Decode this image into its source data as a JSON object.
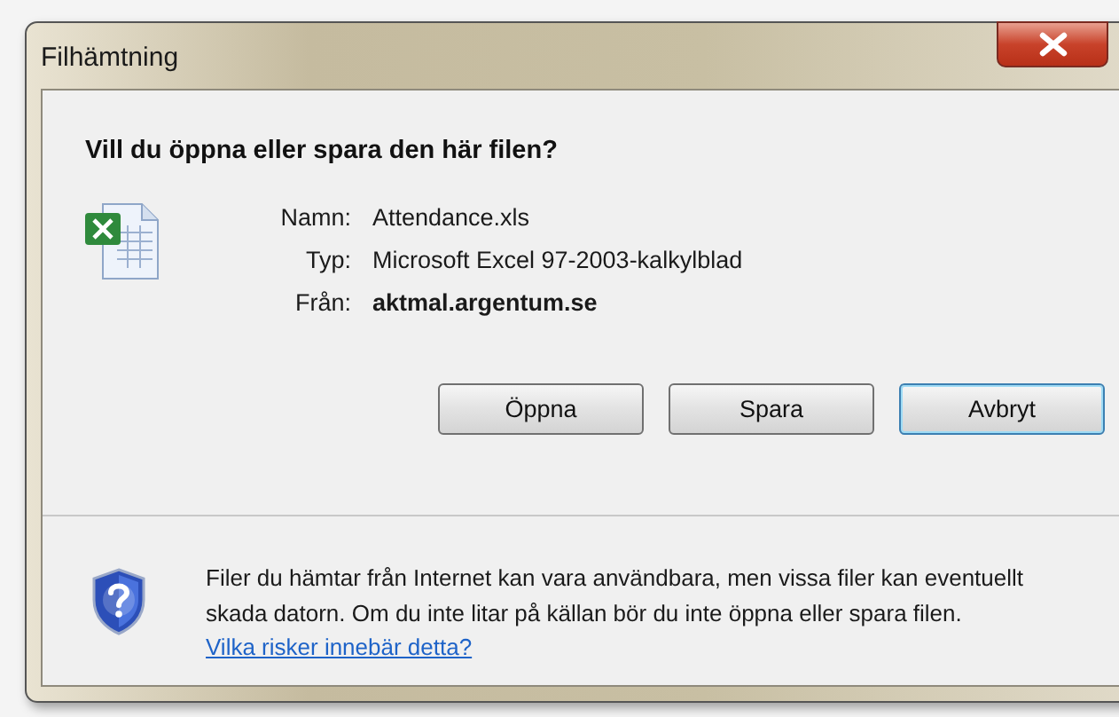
{
  "window": {
    "title": "Filhämtning"
  },
  "heading": "Vill du öppna eller spara den här filen?",
  "file_details": [
    {
      "label": "Namn:",
      "value": "Attendance.xls",
      "bold": false
    },
    {
      "label": "Typ:",
      "value": "Microsoft Excel 97-2003-kalkylblad",
      "bold": false
    },
    {
      "label": "Från:",
      "value": "aktmal.argentum.se",
      "bold": true
    }
  ],
  "buttons": [
    {
      "label": "Öppna",
      "focused": false
    },
    {
      "label": "Spara",
      "focused": false
    },
    {
      "label": "Avbryt",
      "focused": true
    }
  ],
  "warning": {
    "text": "Filer du hämtar från Internet kan vara användbara, men vissa filer kan eventuellt skada datorn. Om du inte litar på källan bör du inte öppna eller spara filen.",
    "link": "Vilka risker innebär detta?"
  }
}
